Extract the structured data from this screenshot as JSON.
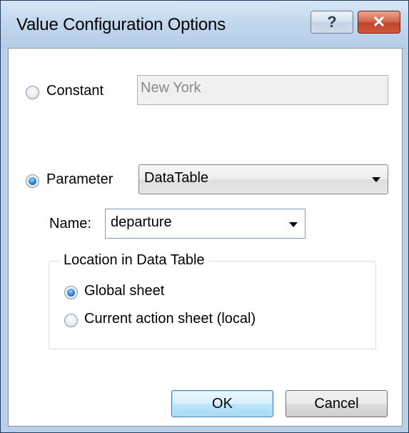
{
  "window": {
    "title": "Value Configuration Options",
    "help_label": "?",
    "close_label": "✕"
  },
  "constant": {
    "label": "Constant",
    "value": "New York",
    "selected": false
  },
  "parameter": {
    "label": "Parameter",
    "selected": true,
    "type_value": "DataTable"
  },
  "name_field": {
    "label": "Name:",
    "value": "departure"
  },
  "location_group": {
    "title": "Location in Data Table",
    "options": [
      {
        "label": "Global sheet",
        "selected": true
      },
      {
        "label": "Current action sheet (local)",
        "selected": false
      }
    ]
  },
  "buttons": {
    "ok_label": "OK",
    "cancel_label": "Cancel"
  }
}
